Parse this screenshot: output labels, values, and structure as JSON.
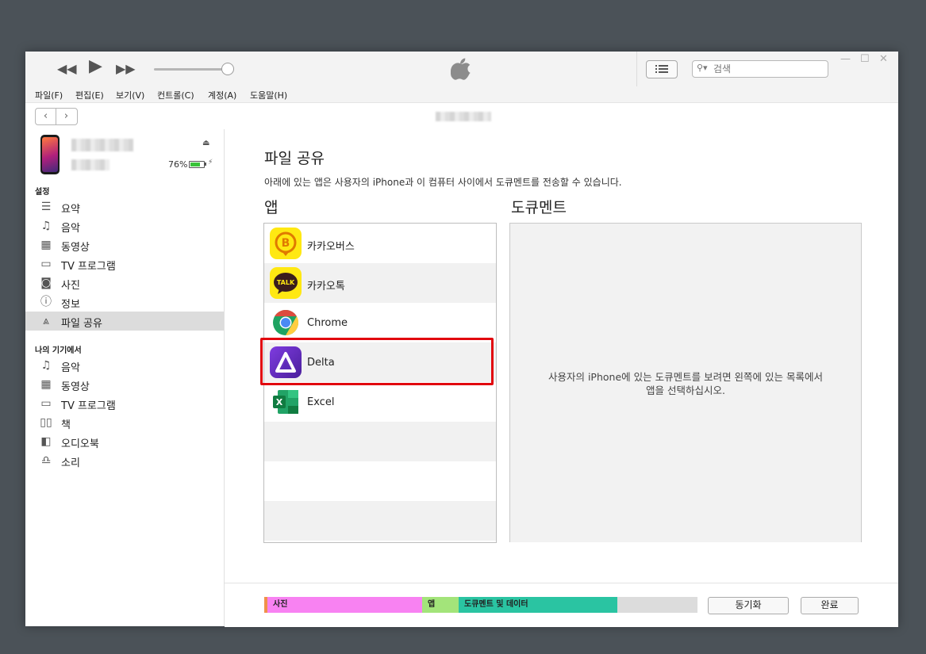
{
  "toolbar": {
    "prev_icon": "◀◀",
    "play_icon": "▶",
    "next_icon": "▶▶",
    "search_placeholder": "검색",
    "minimize_icon": "—",
    "maximize_icon": "☐",
    "close_icon": "✕"
  },
  "menu": [
    "파일(F)",
    "편집(E)",
    "보기(V)",
    "컨트롤(C)",
    "계정(A)",
    "도움말(H)"
  ],
  "nav": {
    "back_icon": "‹",
    "forward_icon": "›"
  },
  "device": {
    "battery_percent_text": "76%",
    "battery_level": 0.76
  },
  "sidebar": {
    "settings_header": "설정",
    "settings_items": [
      {
        "label": "요약",
        "icon": "summary-icon"
      },
      {
        "label": "음악",
        "icon": "music-icon"
      },
      {
        "label": "동영상",
        "icon": "film-icon"
      },
      {
        "label": "TV 프로그램",
        "icon": "tv-icon"
      },
      {
        "label": "사진",
        "icon": "camera-icon"
      },
      {
        "label": "정보",
        "icon": "info-icon"
      },
      {
        "label": "파일 공유",
        "icon": "app-store-icon"
      }
    ],
    "selected": "파일 공유",
    "my_device_header": "나의 기기에서",
    "device_items": [
      {
        "label": "음악",
        "icon": "music-icon"
      },
      {
        "label": "동영상",
        "icon": "film-icon"
      },
      {
        "label": "TV 프로그램",
        "icon": "tv-icon"
      },
      {
        "label": "책",
        "icon": "book-icon"
      },
      {
        "label": "오디오북",
        "icon": "audiobook-icon"
      },
      {
        "label": "소리",
        "icon": "bell-icon"
      }
    ]
  },
  "main": {
    "title": "파일 공유",
    "description": "아래에 있는 앱은 사용자의 iPhone과 이 컴퓨터 사이에서 도큐멘트를 전송할 수 있습니다.",
    "apps_header": "앱",
    "docs_header": "도큐멘트",
    "apps": [
      {
        "label": "카카오버스",
        "icon": "kakaobus-icon"
      },
      {
        "label": "카카오톡",
        "icon": "kakaotalk-icon",
        "icon_text": "TALK"
      },
      {
        "label": "Chrome",
        "icon": "chrome-icon"
      },
      {
        "label": "Delta",
        "icon": "delta-icon"
      },
      {
        "label": "Excel",
        "icon": "excel-icon",
        "icon_text": "X"
      }
    ],
    "highlighted_app": "Delta",
    "docs_message_line1": "사용자의 iPhone에 있는 도큐멘트를 보려면 왼쪽에 있는 목록에서",
    "docs_message_line2": "앱을 선택하십시오."
  },
  "storage": {
    "segments": [
      {
        "label": "",
        "color": "#f0904a",
        "fraction": 0.008
      },
      {
        "label": "사진",
        "color": "#f882f2",
        "fraction": 0.357
      },
      {
        "label": "앱",
        "color": "#a3e47a",
        "fraction": 0.084
      },
      {
        "label": "도큐멘트 및 데이터",
        "color": "#2ac4a2",
        "fraction": 0.366
      },
      {
        "label": "",
        "color": "#dcdcdc",
        "fraction": 0.185
      }
    ]
  },
  "buttons": {
    "sync": "동기화",
    "done": "완료"
  },
  "colors": {
    "highlight_border": "#e1060e",
    "selected_sidebar": "#dcdcdc"
  }
}
